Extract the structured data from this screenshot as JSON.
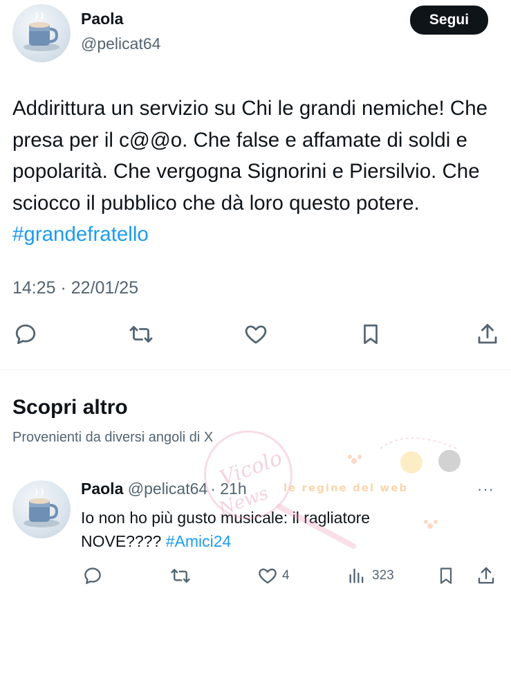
{
  "tweet": {
    "author_name": "Paola",
    "author_handle": "@pelicat64",
    "follow_label": "Segui",
    "text_before": "Addirittura un servizio su Chi le grandi nemiche! Che presa per il c@@o. Che false e affamate di soldi e popolarità. Che vergogna Signorini e Piersilvio. Che sciocco il pubblico che dà loro questo potere. ",
    "hashtag": "#grandefratello",
    "timestamp": "14:25 · 22/01/25",
    "actions": [
      "reply-icon",
      "retweet-icon",
      "like-icon",
      "bookmark-icon",
      "share-icon"
    ]
  },
  "discover": {
    "title": "Scopri altro",
    "subtitle": "Provenienti da diversi angoli di X"
  },
  "recommended": {
    "author_name": "Paola",
    "author_handle": "@pelicat64",
    "time": "· 21h",
    "more": "···",
    "text_before": "Io non ho più gusto musicale: il ragliatore NOVE???? ",
    "hashtag": "#Amici24",
    "likes": "4",
    "views": "323",
    "actions": [
      "reply-icon",
      "retweet-icon",
      "like-icon",
      "views-icon",
      "bookmark-icon",
      "share-icon"
    ]
  },
  "watermark": {
    "stamp_text": "Vicolo delle News",
    "banner_text": "le regine del web"
  },
  "colors": {
    "text": "#0f1419",
    "secondary": "#536471",
    "link": "#1d9bf0",
    "divider": "#eff3f4",
    "button_bg": "#0f1419"
  }
}
